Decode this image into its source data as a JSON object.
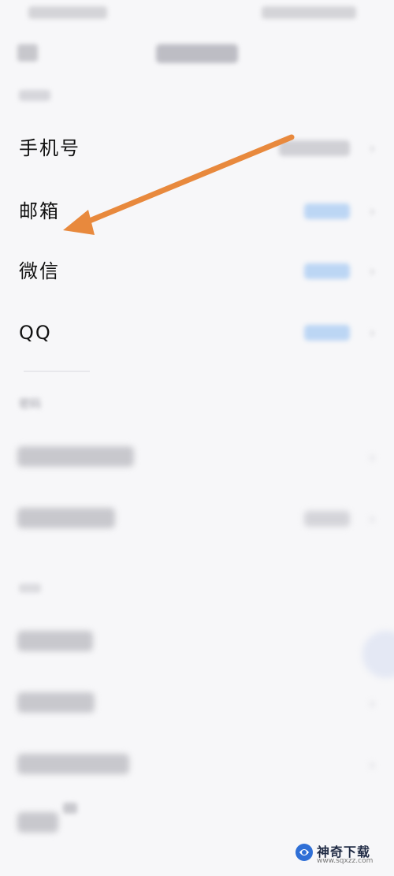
{
  "account_section": {
    "rows": [
      {
        "label": "手机号"
      },
      {
        "label": "邮箱"
      },
      {
        "label": "微信"
      },
      {
        "label": "QQ"
      }
    ]
  },
  "password_section": {
    "header": "密码"
  },
  "annotation": {
    "arrow_color": "#e8893d"
  },
  "watermark": {
    "title": "神奇下载",
    "url": "www.sqxzz.com"
  },
  "icons": {
    "back": "back-arrow-icon",
    "chevron": "chevron-right-icon",
    "annotation": "arrow-annotation-icon"
  }
}
